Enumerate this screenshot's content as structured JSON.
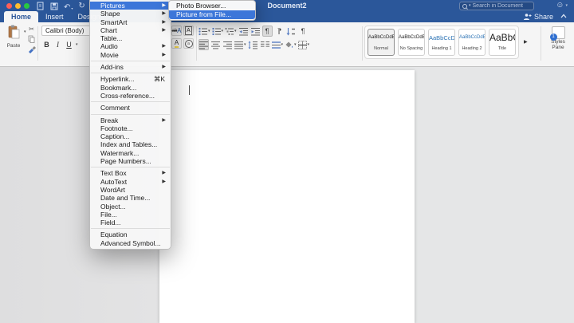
{
  "titlebar": {
    "title": "Document2",
    "search": {
      "placeholder": "Search in Document"
    },
    "share_label": "Share"
  },
  "tabs": {
    "home": "Home",
    "insert": "Insert",
    "design": "Design"
  },
  "ribbon": {
    "paste_label": "Paste",
    "font_name": "Calibri (Body)",
    "bold": "B",
    "italic": "I",
    "underline": "U",
    "style_gallery": [
      {
        "sample": "AaBbCcDdEe",
        "label": "Normal"
      },
      {
        "sample": "AaBbCcDdEe",
        "label": "No Spacing"
      },
      {
        "sample": "AaBbCcDd",
        "label": "Heading 1"
      },
      {
        "sample": "AaBbCcDdEe",
        "label": "Heading 2"
      },
      {
        "sample": "AaBbC",
        "label": "Title"
      }
    ],
    "styles_pane_line1": "Styles",
    "styles_pane_line2": "Pane",
    "styles_pane_badge": "1"
  },
  "menu": {
    "items": [
      {
        "label": "Pictures"
      },
      {
        "label": "Shape"
      },
      {
        "label": "SmartArt"
      },
      {
        "label": "Chart"
      },
      {
        "label": "Table..."
      },
      {
        "label": "Audio"
      },
      {
        "label": "Movie"
      },
      {
        "label": "Add-ins"
      },
      {
        "label": "Hyperlink...",
        "shortcut": "⌘K"
      },
      {
        "label": "Bookmark..."
      },
      {
        "label": "Cross-reference..."
      },
      {
        "label": "Comment"
      },
      {
        "label": "Break"
      },
      {
        "label": "Footnote..."
      },
      {
        "label": "Caption..."
      },
      {
        "label": "Index and Tables..."
      },
      {
        "label": "Watermark..."
      },
      {
        "label": "Page Numbers..."
      },
      {
        "label": "Text Box"
      },
      {
        "label": "AutoText"
      },
      {
        "label": "WordArt"
      },
      {
        "label": "Date and Time..."
      },
      {
        "label": "Object..."
      },
      {
        "label": "File..."
      },
      {
        "label": "Field..."
      },
      {
        "label": "Equation"
      },
      {
        "label": "Advanced Symbol..."
      }
    ]
  },
  "submenu": {
    "items": [
      {
        "label": "Photo Browser..."
      },
      {
        "label": "Picture from File..."
      }
    ]
  },
  "icons": {
    "menu_arrow": "▶",
    "dropdown_caret": "▾",
    "smiley": "☺",
    "undo": "↶",
    "redo": "↻",
    "scissors": "✂",
    "pilcrow": "¶",
    "gallery_arrow": "▶",
    "strike_sample": "ab",
    "letter_a": "A",
    "enclose_char": "a"
  },
  "colors": {
    "titlebar_blue": "#2b579a",
    "menu_highlight_blue": "#3c76d9",
    "heading_style_blue": "#2e74b5"
  }
}
